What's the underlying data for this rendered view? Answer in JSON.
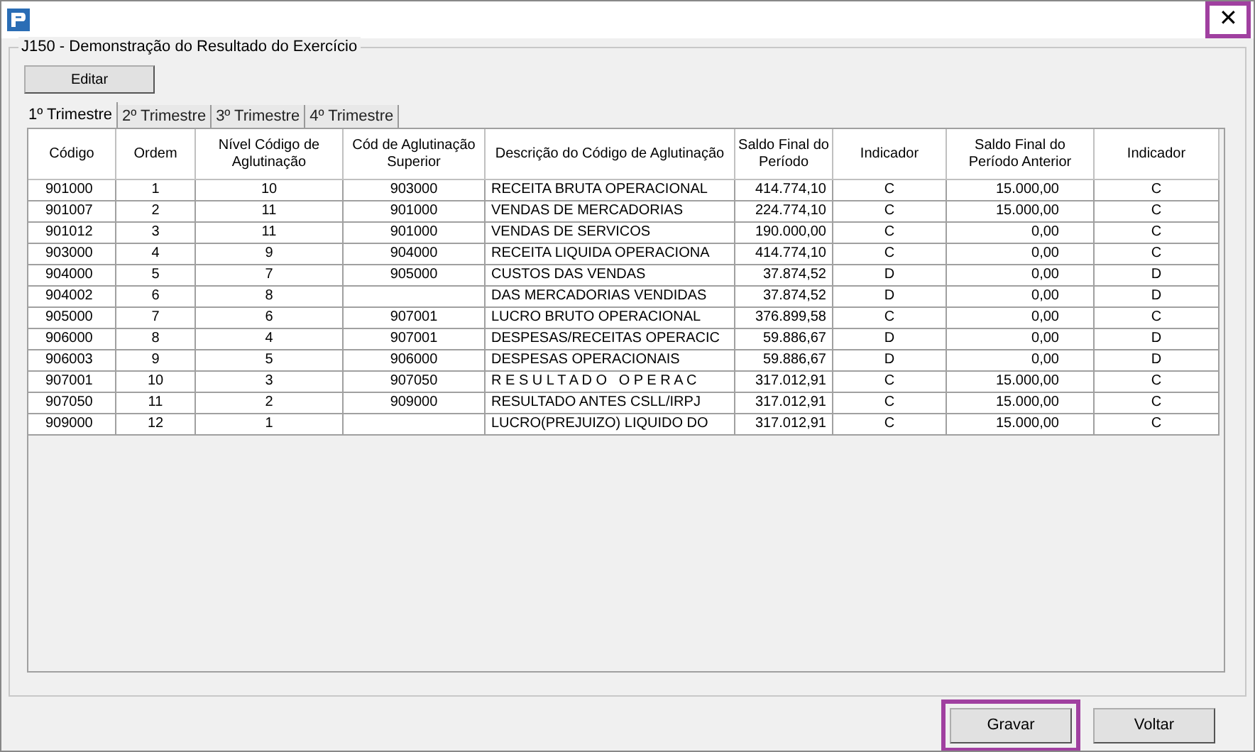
{
  "window": {
    "close": {
      "label": "✕",
      "highlighted": true
    }
  },
  "group": {
    "title": "J150 - Demonstração do Resultado do Exercício"
  },
  "edit_button": "Editar",
  "tabs": [
    {
      "label": "1º Trimestre",
      "selected": true
    },
    {
      "label": "2º Trimestre",
      "selected": false
    },
    {
      "label": "3º Trimestre",
      "selected": false
    },
    {
      "label": "4º Trimestre",
      "selected": false
    }
  ],
  "table": {
    "columns": [
      "Código",
      "Ordem",
      "Nível Código de Aglutinação",
      "Cód de Aglutinação Superior",
      "Descrição do Código de Aglutinação",
      "Saldo Final do Período",
      "Indicador",
      "Saldo Final do Período Anterior",
      "Indicador"
    ],
    "rows": [
      [
        "901000",
        "1",
        "10",
        "903000",
        "RECEITA BRUTA OPERACIONAL",
        "414.774,10",
        "C",
        "15.000,00",
        "C"
      ],
      [
        "901007",
        "2",
        "11",
        "901000",
        "VENDAS DE MERCADORIAS",
        "224.774,10",
        "C",
        "15.000,00",
        "C"
      ],
      [
        "901012",
        "3",
        "11",
        "901000",
        "VENDAS DE SERVICOS",
        "190.000,00",
        "C",
        "0,00",
        "C"
      ],
      [
        "903000",
        "4",
        "9",
        "904000",
        "RECEITA LIQUIDA OPERACIONA",
        "414.774,10",
        "C",
        "0,00",
        "C"
      ],
      [
        "904000",
        "5",
        "7",
        "905000",
        "CUSTOS DAS VENDAS",
        "37.874,52",
        "D",
        "0,00",
        "D"
      ],
      [
        "904002",
        "6",
        "8",
        "",
        "DAS MERCADORIAS VENDIDAS",
        "37.874,52",
        "D",
        "0,00",
        "D"
      ],
      [
        "905000",
        "7",
        "6",
        "907001",
        "LUCRO BRUTO OPERACIONAL",
        "376.899,58",
        "C",
        "0,00",
        "C"
      ],
      [
        "906000",
        "8",
        "4",
        "907001",
        "DESPESAS/RECEITAS OPERACIC",
        "59.886,67",
        "D",
        "0,00",
        "D"
      ],
      [
        "906003",
        "9",
        "5",
        "906000",
        "DESPESAS OPERACIONAIS",
        "59.886,67",
        "D",
        "0,00",
        "D"
      ],
      [
        "907001",
        "10",
        "3",
        "907050",
        "R E S U L T A D O   O P E R A C",
        "317.012,91",
        "C",
        "15.000,00",
        "C"
      ],
      [
        "907050",
        "11",
        "2",
        "909000",
        "RESULTADO ANTES CSLL/IRPJ",
        "317.012,91",
        "C",
        "15.000,00",
        "C"
      ],
      [
        "909000",
        "12",
        "1",
        "",
        "LUCRO(PREJUIZO) LIQUIDO DO",
        "317.012,91",
        "C",
        "15.000,00",
        "C"
      ]
    ]
  },
  "buttons": [
    {
      "label": "Gravar",
      "highlighted": true
    },
    {
      "label": "Voltar",
      "highlighted": false
    }
  ]
}
